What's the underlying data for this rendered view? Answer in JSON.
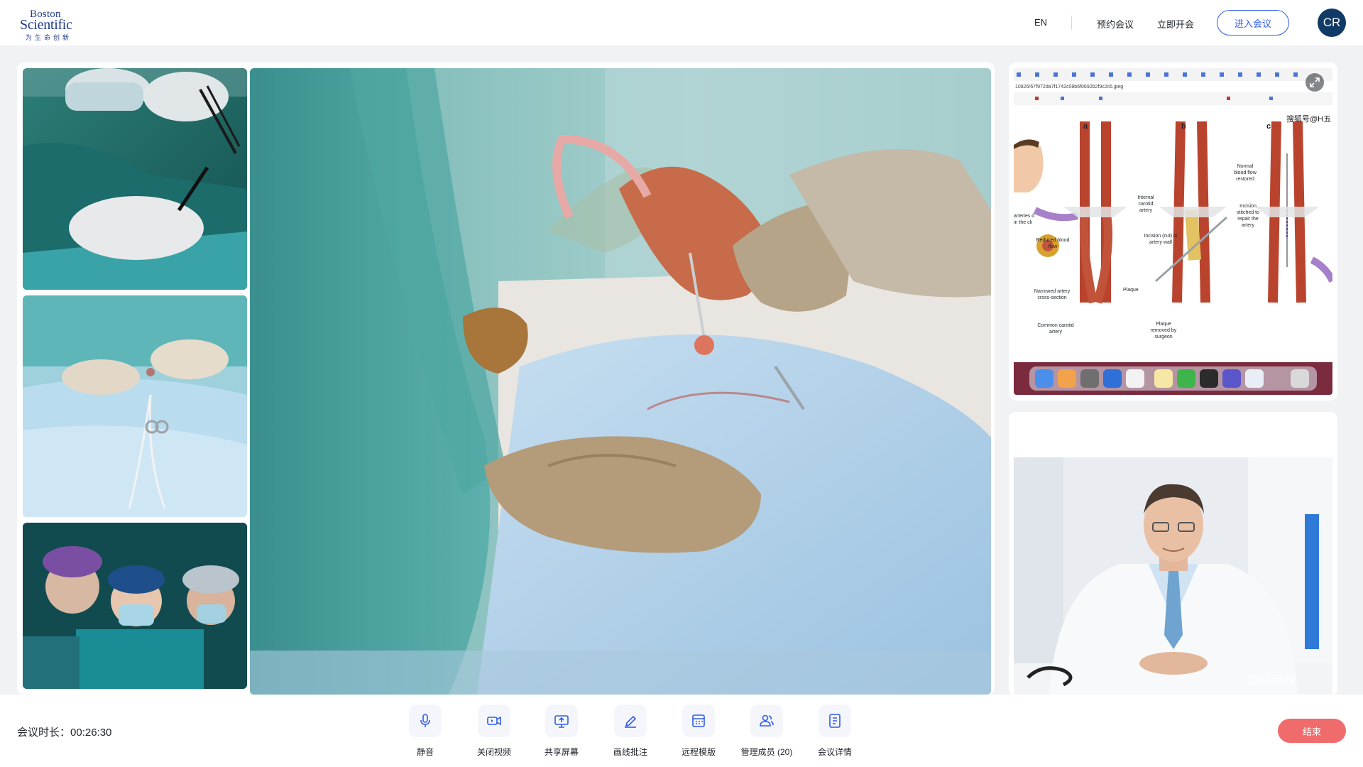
{
  "header": {
    "logo": {
      "line1": "Boston",
      "line2": "Scientific",
      "tagline": "为生命创新"
    },
    "lang": "EN",
    "nav": {
      "schedule": "预约会议",
      "start_now": "立即开会",
      "join": "进入会议"
    },
    "avatar_initials": "CR"
  },
  "colors": {
    "accent": "#2f5bea",
    "end": "#f06b6b",
    "avatar": "#123a66"
  },
  "share_screen": {
    "url": "10826/67f972da7f1742c08b6f0692b2f9c2c6.jpeg",
    "watermark": "搜狐号@H五",
    "fig_labels": [
      "a",
      "b",
      "c"
    ],
    "annotations": {
      "internal_carotid": "Internal carotid artery",
      "reduced_flow": "Reduced blood flow",
      "narrowed": "Narrowed artery cross-section",
      "common_carotid": "Common carotid artery",
      "incision_wall": "Incision (cut) in artery wall",
      "plaque": "Plaque",
      "plaque_removed": "Plaque removed by surgeon",
      "normal_flow": "Normal blood flow restored",
      "incision_stitched": "Incision stitched to repair the artery",
      "arteries_neck": "arteries d in the ck"
    }
  },
  "speaker": {
    "watermark": "摄图·新视"
  },
  "bottom": {
    "duration_label": "会议时长：",
    "duration_value": "00:26:30",
    "tools": [
      {
        "label": "静音",
        "icon": "microphone-icon"
      },
      {
        "label": "关闭视频",
        "icon": "video-camera-icon"
      },
      {
        "label": "共享屏幕",
        "icon": "share-screen-icon"
      },
      {
        "label": "画线批注",
        "icon": "pen-annotate-icon"
      },
      {
        "label": "远程模版",
        "icon": "remote-template-icon"
      },
      {
        "label": "管理成员 (20)",
        "icon": "members-icon"
      },
      {
        "label": "会议详情",
        "icon": "meeting-details-icon"
      }
    ],
    "end_label": "结束"
  }
}
